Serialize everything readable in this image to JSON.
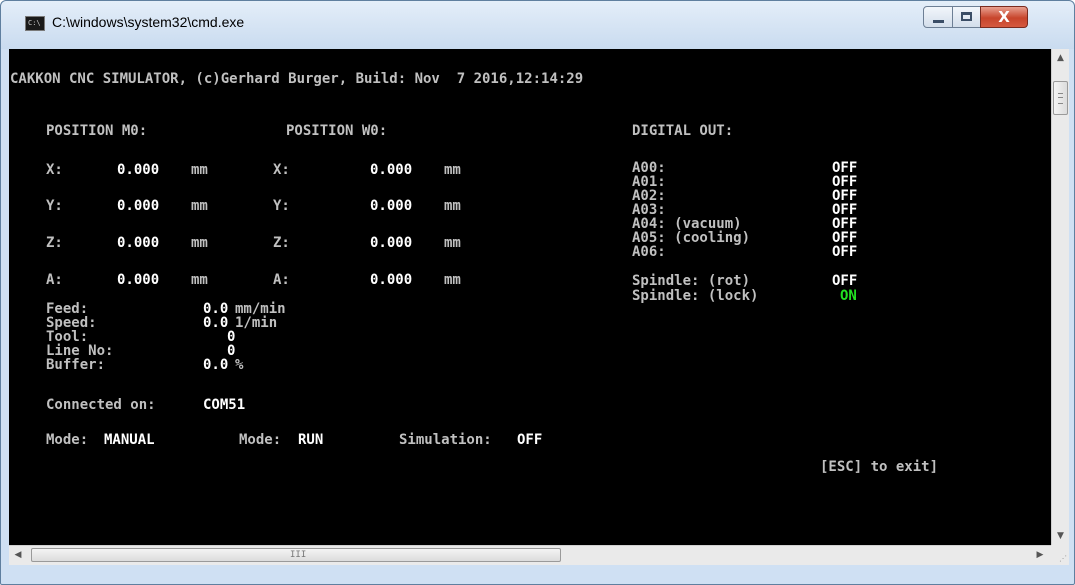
{
  "window": {
    "title": "C:\\windows\\system32\\cmd.exe",
    "icon_label": "C:\\",
    "close_glyph": "X"
  },
  "console": {
    "header": "CAKKON CNC SIMULATOR, (c)Gerhard Burger, Build: Nov  7 2016,12:14:29",
    "position_m0": {
      "title": "POSITION M0:",
      "axes": [
        {
          "label": "X:",
          "value": "0.000",
          "unit": "mm"
        },
        {
          "label": "Y:",
          "value": "0.000",
          "unit": "mm"
        },
        {
          "label": "Z:",
          "value": "0.000",
          "unit": "mm"
        },
        {
          "label": "A:",
          "value": "0.000",
          "unit": "mm"
        }
      ]
    },
    "position_w0": {
      "title": "POSITION W0:",
      "axes": [
        {
          "label": "X:",
          "value": "0.000",
          "unit": "mm"
        },
        {
          "label": "Y:",
          "value": "0.000",
          "unit": "mm"
        },
        {
          "label": "Z:",
          "value": "0.000",
          "unit": "mm"
        },
        {
          "label": "A:",
          "value": "0.000",
          "unit": "mm"
        }
      ]
    },
    "digital_out": {
      "title": "DIGITAL OUT:",
      "outputs": [
        {
          "label": "A00:",
          "state": "OFF"
        },
        {
          "label": "A01:",
          "state": "OFF"
        },
        {
          "label": "A02:",
          "state": "OFF"
        },
        {
          "label": "A03:",
          "state": "OFF"
        },
        {
          "label": "A04: (vacuum)",
          "state": "OFF"
        },
        {
          "label": "A05: (cooling)",
          "state": "OFF"
        },
        {
          "label": "A06:",
          "state": "OFF"
        }
      ],
      "spindle": [
        {
          "label": "Spindle: (rot)",
          "state": "OFF"
        },
        {
          "label": "Spindle: (lock)",
          "state": "ON"
        }
      ]
    },
    "status": {
      "feed": {
        "label": "Feed:",
        "value": "0.0",
        "unit": "mm/min"
      },
      "speed": {
        "label": "Speed:",
        "value": "0.0",
        "unit": "1/min"
      },
      "tool": {
        "label": "Tool:",
        "value": "0"
      },
      "line_no": {
        "label": "Line No:",
        "value": "0"
      },
      "buffer": {
        "label": "Buffer:",
        "value": "0.0",
        "unit": "%"
      }
    },
    "connection": {
      "label": "Connected on:",
      "port": "COM51"
    },
    "modes": [
      {
        "label": "Mode:",
        "value": "MANUAL"
      },
      {
        "label": "Mode:",
        "value": "RUN"
      },
      {
        "label": "Simulation:",
        "value": "OFF"
      }
    ],
    "exit_hint": "[ESC] to exit]"
  },
  "scrollbars": {
    "up_arrow": "▲",
    "down_arrow": "▼",
    "left_arrow": "◀",
    "right_arrow": "▶",
    "h_grip": "III"
  },
  "colors": {
    "console_bg": "#000000",
    "console_text": "#c0c0c0",
    "value_text": "#ffffff",
    "on_state": "#22e022"
  }
}
